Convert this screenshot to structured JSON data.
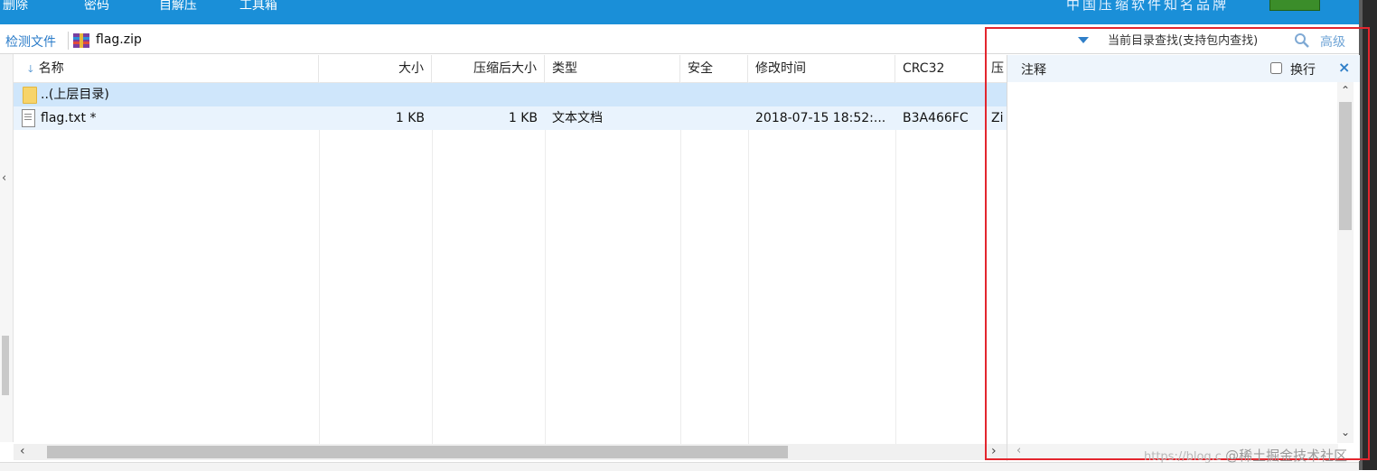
{
  "toolbar": {
    "items": [
      "删除",
      "密码",
      "自解压",
      "工具箱"
    ],
    "brand": "中国压缩软件知名品牌"
  },
  "address": {
    "detect_label": "检测文件",
    "path": "flag.zip",
    "search_placeholder": "当前目录查找(支持包内查找)",
    "advanced_label": "高级"
  },
  "columns": [
    "名称",
    "大小",
    "压缩后大小",
    "类型",
    "安全",
    "修改时间",
    "CRC32",
    "压"
  ],
  "rows": [
    {
      "name": "..(上层目录)",
      "size": "",
      "packed": "",
      "type": "",
      "secure": "",
      "mtime": "",
      "crc": "",
      "method": ""
    },
    {
      "name": "flag.txt *",
      "size": "1 KB",
      "packed": "1 KB",
      "type": "文本文档",
      "secure": "",
      "mtime": "2018-07-15 18:52:...",
      "crc": "B3A466FC",
      "method": "Zi"
    }
  ],
  "comment_panel": {
    "title": "注释",
    "wrap_label": "换行",
    "close_icon": "×",
    "content": ""
  },
  "watermark": {
    "url": "https://blog.c",
    "text": "@稀土掘金技术社区"
  },
  "colors": {
    "toolbar_bg": "#1a8fd8",
    "selected_row": "#cfe6fb",
    "highlight_box": "#e3262e",
    "accent": "#2f7fc8"
  }
}
